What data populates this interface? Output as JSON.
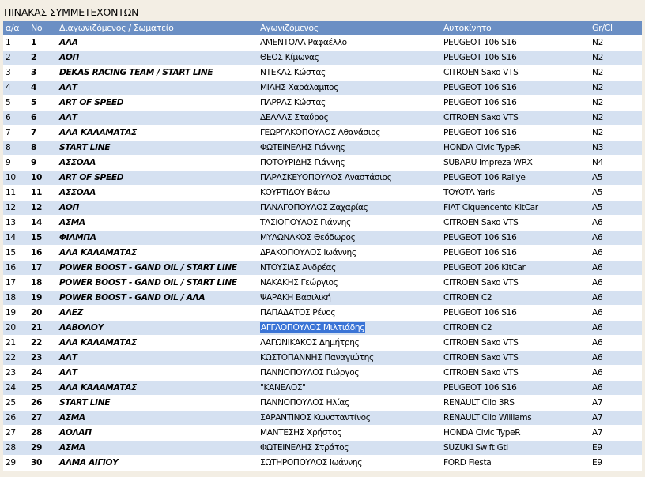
{
  "page": {
    "title": "ΠΙΝΑΚΑΣ ΣΥΜΜΕΤΕΧΟΝΤΩΝ"
  },
  "table": {
    "headers": [
      "α/α",
      "Νο",
      "Διαγωνιζόμενος / Σωματείο",
      "Αγωνιζόμενος",
      "Αυτοκίνητο",
      "Gr/Cl"
    ],
    "rows": [
      {
        "aa": "1",
        "no": "1",
        "team": "ΑΛΑ",
        "driver": "ΑΜΕΝΤΟΛΑ Ραφαέλλο",
        "car": "PEUGEOT 106 S16",
        "cls": "N2"
      },
      {
        "aa": "2",
        "no": "2",
        "team": "ΑΟΠ",
        "driver": "ΘΕΟΣ Κίμωνας",
        "car": "PEUGEOT 106 S16",
        "cls": "N2"
      },
      {
        "aa": "3",
        "no": "3",
        "team": "DEKAS RACING TEAM / START LINE",
        "driver": "ΝΤΕΚΑΣ Κώστας",
        "car": "CITROEN Saxo VTS",
        "cls": "N2"
      },
      {
        "aa": "4",
        "no": "4",
        "team": "ΑΛΤ",
        "driver": "ΜΙΛΗΣ Χαράλαμπος",
        "car": "PEUGEOT 106 S16",
        "cls": "N2"
      },
      {
        "aa": "5",
        "no": "5",
        "team": "ART OF SPEED",
        "driver": "ΠΑΡΡΑΣ Κώστας",
        "car": "PEUGEOT 106 S16",
        "cls": "N2"
      },
      {
        "aa": "6",
        "no": "6",
        "team": "ΑΛΤ",
        "driver": "ΔΕΛΛΑΣ Σταύρος",
        "car": "CITROEN Saxo VTS",
        "cls": "N2"
      },
      {
        "aa": "7",
        "no": "7",
        "team": "ΑΛΑ ΚΑΛΑΜΑΤΑΣ",
        "driver": "ΓΕΩΡΓΑΚΟΠΟΥΛΟΣ Αθανάσιος",
        "car": "PEUGEOT 106 S16",
        "cls": "N2"
      },
      {
        "aa": "8",
        "no": "8",
        "team": "START LINE",
        "driver": "ΦΩΤΕΙΝΕΛΗΣ Γιάννης",
        "car": "HONDA Civic TypeR",
        "cls": "N3"
      },
      {
        "aa": "9",
        "no": "9",
        "team": "ΑΣΣΟΑΑ",
        "driver": "ΠΟΤΟΥΡΙΔΗΣ Γιάννης",
        "car": "SUBARU Impreza WRX",
        "cls": "N4"
      },
      {
        "aa": "10",
        "no": "10",
        "team": "ART OF SPEED",
        "driver": "ΠΑΡΑΣΚΕΥΟΠΟΥΛΟΣ Αναστάσιος",
        "car": "PEUGEOT 106 Rallye",
        "cls": "A5"
      },
      {
        "aa": "11",
        "no": "11",
        "team": "ΑΣΣΟΑΑ",
        "driver": "ΚΟΥΡΤΙΔΟΥ Βάσω",
        "car": "TOYOTA Yaris",
        "cls": "A5"
      },
      {
        "aa": "12",
        "no": "12",
        "team": "ΑΟΠ",
        "driver": "ΠΑΝΑΓΟΠΟΥΛΟΣ Ζαχαρίας",
        "car": "FIAT Ciquencento KitCar",
        "cls": "A5"
      },
      {
        "aa": "13",
        "no": "14",
        "team": "ΑΣΜΑ",
        "driver": "ΤΑΣΙΟΠΟΥΛΟΣ Γιάννης",
        "car": "CITROEN Saxo VTS",
        "cls": "A6"
      },
      {
        "aa": "14",
        "no": "15",
        "team": "ΦΙΛΜΠΑ",
        "driver": "ΜΥΛΩΝΑΚΟΣ Θεόδωρος",
        "car": "PEUGEOT 106 S16",
        "cls": "A6"
      },
      {
        "aa": "15",
        "no": "16",
        "team": "ΑΛΑ ΚΑΛΑΜΑΤΑΣ",
        "driver": "ΔΡΑΚΟΠΟΥΛΟΣ Ιωάννης",
        "car": "PEUGEOT 106 S16",
        "cls": "A6"
      },
      {
        "aa": "16",
        "no": "17",
        "team": "POWER BOOST - GAND OIL / START LINE",
        "driver": "ΝΤΟΥΣΙΑΣ Ανδρέας",
        "car": "PEUGEOT 206 KitCar",
        "cls": "A6"
      },
      {
        "aa": "17",
        "no": "18",
        "team": "POWER BOOST - GAND OIL / START LINE",
        "driver": "ΝΑΚΑΚΗΣ Γεώργιος",
        "car": "CITROEN Saxo VTS",
        "cls": "A6"
      },
      {
        "aa": "18",
        "no": "19",
        "team": "POWER BOOST - GAND OIL / ΑΛΑ",
        "driver": "ΨΑΡΑΚΗ Βασιλική",
        "car": "CITROEN C2",
        "cls": "A6"
      },
      {
        "aa": "19",
        "no": "20",
        "team": "ΑΛΕΖ",
        "driver": "ΠΑΠΑΔΑΤΟΣ Ρένος",
        "car": "PEUGEOT 106 S16",
        "cls": "A6"
      },
      {
        "aa": "20",
        "no": "21",
        "team": "ΛΑΒΟΛΟΥ",
        "driver": "ΑΓΓΛΟΠΟΥΛΟΣ Μιλτιάδης",
        "car": "CITROEN C2",
        "cls": "A6",
        "highlight": true
      },
      {
        "aa": "21",
        "no": "22",
        "team": "ΑΛΑ ΚΑΛΑΜΑΤΑΣ",
        "driver": "ΛΑΓΩΝΙΚΑΚΟΣ Δημήτρης",
        "car": "CITROEN Saxo VTS",
        "cls": "A6"
      },
      {
        "aa": "22",
        "no": "23",
        "team": "ΑΛΤ",
        "driver": "ΚΩΣΤΟΠΑΝΝΗΣ Παναγιώτης",
        "car": "CITROEN Saxo VTS",
        "cls": "A6"
      },
      {
        "aa": "23",
        "no": "24",
        "team": "ΑΛΤ",
        "driver": "ΠΑΝΝΟΠΟΥΛΟΣ Γιώργος",
        "car": "CITROEN Saxo VTS",
        "cls": "A6"
      },
      {
        "aa": "24",
        "no": "25",
        "team": "ΑΛΑ ΚΑΛΑΜΑΤΑΣ",
        "driver": "\"ΚΑΝΕΛΟΣ\"",
        "car": "PEUGEOT 106 S16",
        "cls": "A6"
      },
      {
        "aa": "25",
        "no": "26",
        "team": "START LINE",
        "driver": "ΠΑΝΝΟΠΟΥΛΟΣ Ηλίας",
        "car": "RENAULT Clio 3RS",
        "cls": "A7"
      },
      {
        "aa": "26",
        "no": "27",
        "team": "ΑΣΜΑ",
        "driver": "ΣΑΡΑΝΤΙΝΟΣ Κωνσταντίνος",
        "car": "RENAULT Clio Williams",
        "cls": "A7"
      },
      {
        "aa": "27",
        "no": "28",
        "team": "ΑΟΛΑΠ",
        "driver": "ΜΑΝΤΕΣΗΣ Χρήστος",
        "car": "HONDA Civic TypeR",
        "cls": "A7"
      },
      {
        "aa": "28",
        "no": "29",
        "team": "ΑΣΜΑ",
        "driver": "ΦΩΤΕΙΝΕΛΗΣ Στράτος",
        "car": "SUZUKI Swift Gti",
        "cls": "E9"
      },
      {
        "aa": "29",
        "no": "30",
        "team": "ΑΛΜΑ ΑΙΓΙΟΥ",
        "driver": "ΣΩΤΗΡΟΠΟΥΛΟΣ Ιωάννης",
        "car": "FORD Fiesta",
        "cls": "E9"
      }
    ]
  },
  "colors": {
    "header_bg": "#6b8fc4",
    "row_odd": "#ffffff",
    "row_even": "#d5e1f1",
    "selection": "#3a74d6",
    "page_bg": "#f3eee4"
  }
}
